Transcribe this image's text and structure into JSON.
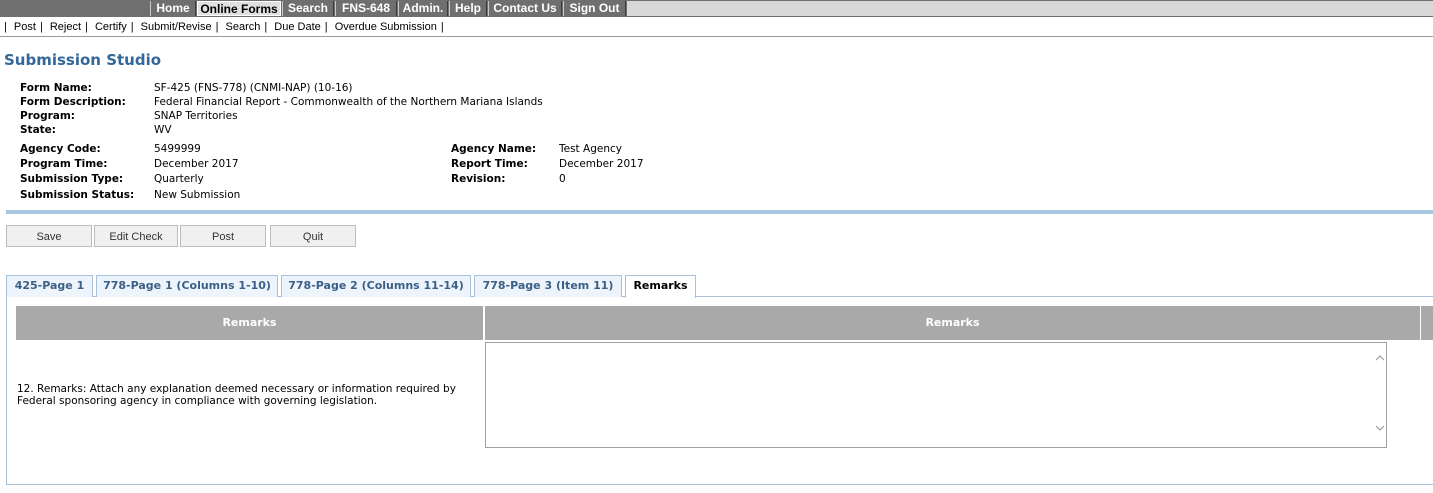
{
  "topnav": {
    "items": [
      {
        "label": "Home"
      },
      {
        "label": "Online Forms"
      },
      {
        "label": "Search"
      },
      {
        "label": "FNS-648"
      },
      {
        "label": "Admin."
      },
      {
        "label": "Help"
      },
      {
        "label": "Contact Us"
      },
      {
        "label": "Sign Out"
      }
    ]
  },
  "subnav": {
    "items": [
      "Post",
      "Reject",
      "Certify",
      "Submit/Revise",
      "Search",
      "Due Date",
      "Overdue Submission"
    ]
  },
  "page": {
    "title": "Submission Studio"
  },
  "info": {
    "form_name_label": "Form Name:",
    "form_name": "SF-425 (FNS-778) (CNMI-NAP) (10-16)",
    "form_desc_label": "Form Description:",
    "form_desc": "Federal Financial Report - Commonwealth of the Northern Mariana Islands",
    "program_label": "Program:",
    "program": "SNAP Territories",
    "state_label": "State:",
    "state": "WV",
    "agency_code_label": "Agency Code:",
    "agency_code": "5499999",
    "agency_name_label": "Agency Name:",
    "agency_name": "Test Agency",
    "program_time_label": "Program Time:",
    "program_time": "December 2017",
    "report_time_label": "Report Time:",
    "report_time": "December 2017",
    "submission_type_label": "Submission Type:",
    "submission_type": "Quarterly",
    "revision_label": "Revision:",
    "revision": "0",
    "submission_status_label": "Submission Status:",
    "submission_status": "New Submission"
  },
  "buttons": {
    "save": "Save",
    "edit_check": "Edit Check",
    "post": "Post",
    "quit": "Quit"
  },
  "tabs": [
    {
      "label": "425-Page 1"
    },
    {
      "label": "778-Page 1 (Columns 1-10)"
    },
    {
      "label": "778-Page 2 (Columns 11-14)"
    },
    {
      "label": "778-Page 3 (Item 11)"
    },
    {
      "label": "Remarks"
    }
  ],
  "remarks": {
    "col1_header": "Remarks",
    "col2_header": "Remarks",
    "item_text": "12. Remarks: Attach any explanation deemed necessary or information required by Federal sponsoring agency in compliance with governing legislation.",
    "textarea_value": ""
  },
  "icons": {
    "scroll_up": "chevron-up-icon",
    "scroll_down": "chevron-down-icon"
  }
}
